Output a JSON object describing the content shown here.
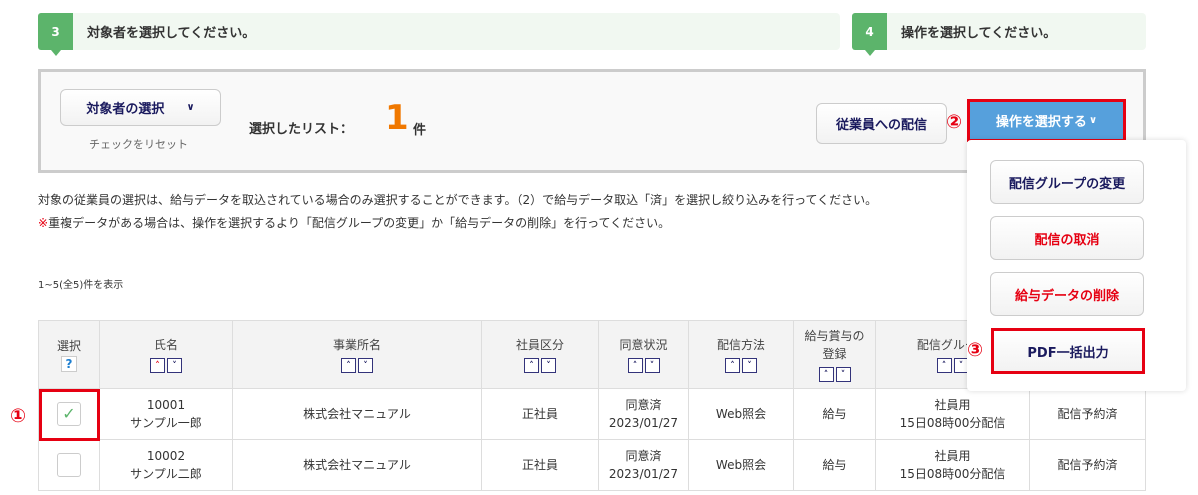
{
  "steps": [
    {
      "num": "3",
      "text": "対象者を選択してください。"
    },
    {
      "num": "4",
      "text": "操作を選択してください。"
    }
  ],
  "panel": {
    "select_label": "対象者の選択",
    "reset_link": "チェックをリセット",
    "selected_label": "選択したリスト：",
    "selected_count": "1",
    "count_unit": "件",
    "deliver_button": "従業員への配信",
    "operation_button": "操作を選択する"
  },
  "annotations": {
    "a1": "①",
    "a2": "②",
    "a3": "③"
  },
  "notes": {
    "line1": "対象の従業員の選択は、給与データを取込されている場合のみ選択することができます。（2）で給与データ取込「済」を選択し絞り込みを行ってください。",
    "mark": "※",
    "line2": "重複データがある場合は、操作を選択するより「配信グループの変更」か「給与データの削除」を行ってください。",
    "range": "1~5(全5)件を表示"
  },
  "dropdown": {
    "items": [
      {
        "label": "配信グループの変更",
        "color": "#1a1a5e"
      },
      {
        "label": "配信の取消",
        "color": "#e60012"
      },
      {
        "label": "給与データの削除",
        "color": "#e60012"
      },
      {
        "label": "PDF一括出力",
        "color": "#1a1a5e"
      }
    ]
  },
  "table": {
    "headers": [
      "選択",
      "氏名",
      "事業所名",
      "社員区分",
      "同意状況",
      "配信方法",
      "給与賞与の登録",
      "配信グループ",
      ""
    ],
    "help": "?",
    "rows": [
      {
        "checked": true,
        "id": "10001",
        "name": "サンプル一郎",
        "office": "株式会社マニュアル",
        "type": "正社員",
        "consent": "同意済",
        "date": "2023/01/27",
        "method": "Web照会",
        "reg": "給与",
        "group": "社員用",
        "schedule": "15日08時00分配信",
        "status": "配信予約済"
      },
      {
        "checked": false,
        "id": "10002",
        "name": "サンプル二郎",
        "office": "株式会社マニュアル",
        "type": "正社員",
        "consent": "同意済",
        "date": "2023/01/27",
        "method": "Web照会",
        "reg": "給与",
        "group": "社員用",
        "schedule": "15日08時00分配信",
        "status": "配信予約済"
      }
    ]
  }
}
